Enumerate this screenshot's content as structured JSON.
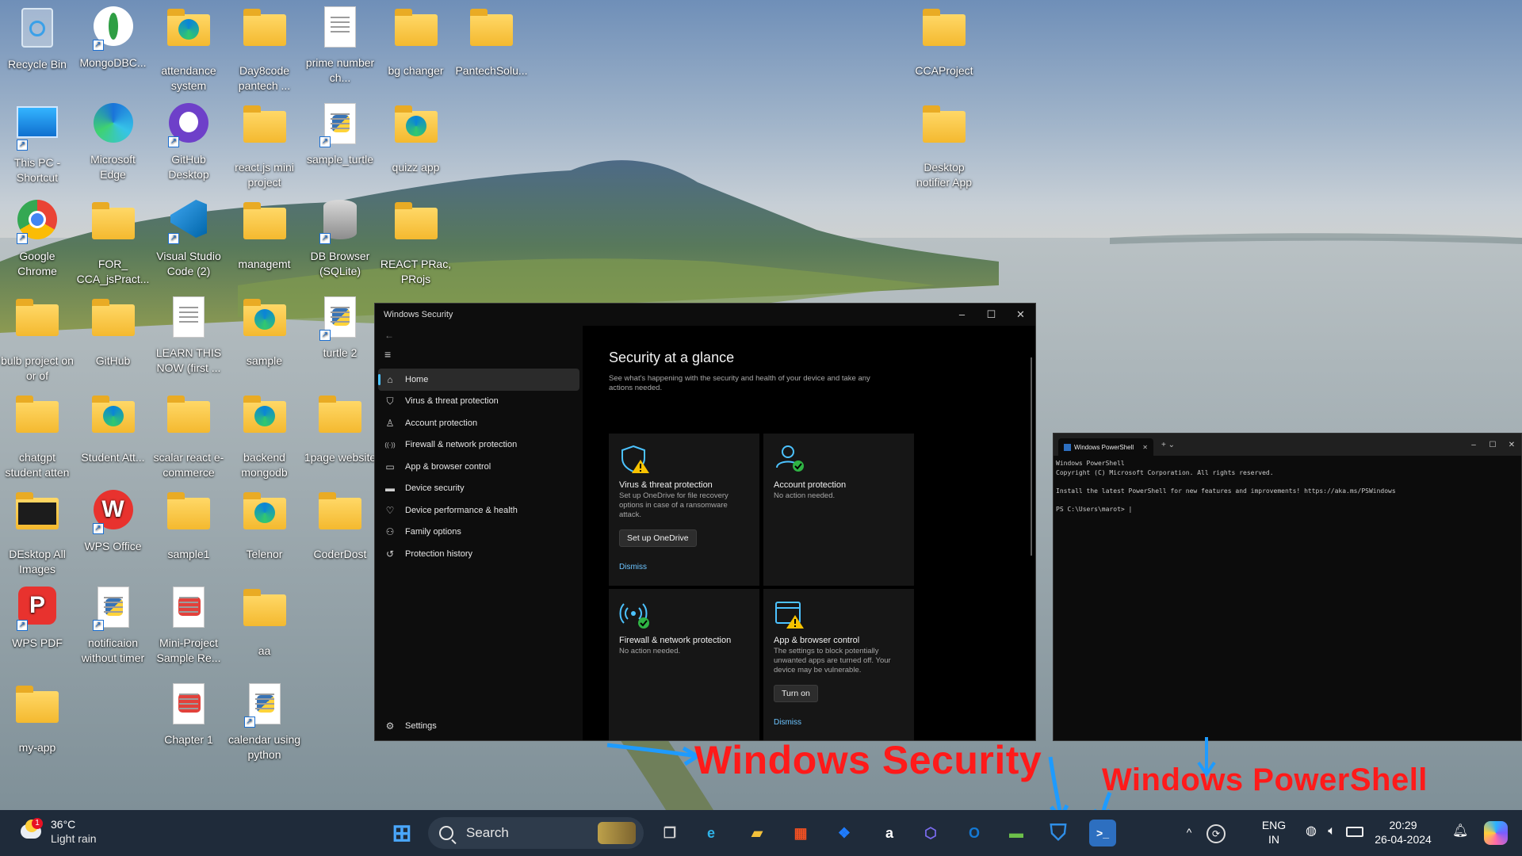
{
  "desktop_icons": [
    {
      "label": "Recycle Bin",
      "kind": "recycle-bin",
      "col": 0,
      "row": 0
    },
    {
      "label": "MongoDBC...",
      "kind": "mongodb",
      "col": 1,
      "row": 0
    },
    {
      "label": "attendance system",
      "kind": "folder-edge",
      "col": 2,
      "row": 0
    },
    {
      "label": "Day8code pantech ...",
      "kind": "folder",
      "col": 3,
      "row": 0
    },
    {
      "label": "prime number ch...",
      "kind": "document",
      "col": 4,
      "row": 0
    },
    {
      "label": "bg changer",
      "kind": "folder",
      "col": 5,
      "row": 0
    },
    {
      "label": "PantechSolu...",
      "kind": "folder",
      "col": 6,
      "row": 0
    },
    {
      "label": "CCAProject",
      "kind": "folder",
      "col": 12,
      "row": 0
    },
    {
      "label": "This PC - Shortcut",
      "kind": "monitor",
      "col": 0,
      "row": 1
    },
    {
      "label": "Microsoft Edge",
      "kind": "edge",
      "col": 1,
      "row": 1
    },
    {
      "label": "GitHub Desktop",
      "kind": "github",
      "col": 2,
      "row": 1
    },
    {
      "label": "react.js mini project",
      "kind": "folder",
      "col": 3,
      "row": 1
    },
    {
      "label": "sample_turtle",
      "kind": "python",
      "col": 4,
      "row": 1
    },
    {
      "label": "quizz app",
      "kind": "folder-edge",
      "col": 5,
      "row": 1
    },
    {
      "label": "Desktop notifier App",
      "kind": "folder",
      "col": 12,
      "row": 1
    },
    {
      "label": "Google Chrome",
      "kind": "chrome",
      "col": 0,
      "row": 2
    },
    {
      "label": "FOR_ CCA_jsPract...",
      "kind": "folder",
      "col": 1,
      "row": 2
    },
    {
      "label": "Visual Studio Code (2)",
      "kind": "vscode",
      "col": 2,
      "row": 2
    },
    {
      "label": "managemt",
      "kind": "folder",
      "col": 3,
      "row": 2
    },
    {
      "label": "DB Browser (SQLite)",
      "kind": "database",
      "col": 4,
      "row": 2
    },
    {
      "label": "REACT PRac, PRojs",
      "kind": "folder",
      "col": 5,
      "row": 2
    },
    {
      "label": "bulb project on or of",
      "kind": "folder",
      "col": 0,
      "row": 3
    },
    {
      "label": "GitHub",
      "kind": "folder",
      "col": 1,
      "row": 3
    },
    {
      "label": "LEARN THIS NOW (first ...",
      "kind": "document",
      "col": 2,
      "row": 3
    },
    {
      "label": "sample",
      "kind": "folder-edge",
      "col": 3,
      "row": 3
    },
    {
      "label": "turtle 2",
      "kind": "python",
      "col": 4,
      "row": 3
    },
    {
      "label": "chatgpt student atten",
      "kind": "folder",
      "col": 0,
      "row": 4
    },
    {
      "label": "Student Att...",
      "kind": "folder-edge",
      "col": 1,
      "row": 4
    },
    {
      "label": "scalar react e-commerce",
      "kind": "folder",
      "col": 2,
      "row": 4
    },
    {
      "label": "backend mongodb",
      "kind": "folder-edge",
      "col": 3,
      "row": 4
    },
    {
      "label": "1page website",
      "kind": "folder",
      "col": 4,
      "row": 4
    },
    {
      "label": "DEsktop All Images",
      "kind": "folder-dark",
      "col": 0,
      "row": 5
    },
    {
      "label": "WPS Office",
      "kind": "wps",
      "col": 1,
      "row": 5
    },
    {
      "label": "sample1",
      "kind": "folder",
      "col": 2,
      "row": 5
    },
    {
      "label": "Telenor",
      "kind": "folder-edge",
      "col": 3,
      "row": 5
    },
    {
      "label": "CoderDost",
      "kind": "folder",
      "col": 4,
      "row": 5
    },
    {
      "label": "WPS PDF",
      "kind": "wps-pdf",
      "col": 0,
      "row": 6
    },
    {
      "label": "notificaion without timer",
      "kind": "python",
      "col": 1,
      "row": 6
    },
    {
      "label": "Mini-Project Sample Re...",
      "kind": "pdf",
      "col": 2,
      "row": 6
    },
    {
      "label": "aa",
      "kind": "folder",
      "col": 3,
      "row": 6
    },
    {
      "label": "my-app",
      "kind": "folder",
      "col": 0,
      "row": 7
    },
    {
      "label": "Chapter 1",
      "kind": "pdf",
      "col": 2,
      "row": 7
    },
    {
      "label": "calendar using python",
      "kind": "python",
      "col": 3,
      "row": 7
    }
  ],
  "security_window": {
    "title": "Windows Security",
    "controls": {
      "minimize": "–",
      "maximize": "☐",
      "close": "✕"
    },
    "back": "←",
    "menu": "≡",
    "nav": [
      {
        "label": "Home",
        "icon": "home-icon",
        "glyph": "⌂",
        "active": true
      },
      {
        "label": "Virus & threat protection",
        "icon": "shield-icon",
        "glyph": "⛉",
        "active": false
      },
      {
        "label": "Account protection",
        "icon": "person-icon",
        "glyph": "♙",
        "active": false
      },
      {
        "label": "Firewall & network protection",
        "icon": "antenna-icon",
        "glyph": "((·))",
        "active": false
      },
      {
        "label": "App & browser control",
        "icon": "browser-icon",
        "glyph": "▭",
        "active": false
      },
      {
        "label": "Device security",
        "icon": "laptop-icon",
        "glyph": "▬",
        "active": false
      },
      {
        "label": "Device performance & health",
        "icon": "heart-icon",
        "glyph": "♡",
        "active": false
      },
      {
        "label": "Family options",
        "icon": "family-icon",
        "glyph": "⚇",
        "active": false
      },
      {
        "label": "Protection history",
        "icon": "history-icon",
        "glyph": "↺",
        "active": false
      }
    ],
    "settings_label": "Settings",
    "heading": "Security at a glance",
    "subheading": "See what's happening with the security and health of your device and take any actions needed.",
    "cards": [
      {
        "title": "Virus & threat protection",
        "desc": "Set up OneDrive for file recovery options in case of a ransomware attack.",
        "button": "Set up OneDrive",
        "link": "Dismiss",
        "status": "warning",
        "icon": "shield-warning-icon"
      },
      {
        "title": "Account protection",
        "desc": "No action needed.",
        "button": "",
        "link": "",
        "status": "ok",
        "icon": "account-ok-icon"
      },
      {
        "title": "Firewall & network protection",
        "desc": "No action needed.",
        "button": "",
        "link": "",
        "status": "ok",
        "icon": "firewall-ok-icon"
      },
      {
        "title": "App & browser control",
        "desc": "The settings to block potentially unwanted apps are turned off. Your device may be vulnerable.",
        "button": "Turn on",
        "link": "Dismiss",
        "status": "warning",
        "icon": "browser-warning-icon"
      }
    ]
  },
  "powershell_window": {
    "tab_title": "Windows PowerShell",
    "tab_close": "✕",
    "new_tab": "+  ⌄",
    "controls": {
      "minimize": "–",
      "maximize": "☐",
      "close": "✕"
    },
    "lines": [
      "Windows PowerShell",
      "Copyright (C) Microsoft Corporation. All rights reserved.",
      "",
      "Install the latest PowerShell for new features and improvements! https://aka.ms/PSWindows",
      "",
      "PS C:\\Users\\marot> |"
    ]
  },
  "annotations": {
    "security_label": "Windows Security",
    "powershell_label": "Windows PowerShell",
    "color": "#ff1a1a",
    "arrow_color": "#1e9bff"
  },
  "taskbar": {
    "weather_temp": "36°C",
    "weather_cond": "Light rain",
    "weather_badge": "1",
    "search_placeholder": "Search",
    "pinned_apps": [
      {
        "name": "start-button",
        "glyph": "⊞",
        "color": "#4aa8ff"
      },
      {
        "name": "task-view-button",
        "glyph": "❐",
        "color": "#d0d0d0"
      },
      {
        "name": "edge-taskbar-icon",
        "glyph": "e",
        "color": "#2fb3e8"
      },
      {
        "name": "file-explorer-taskbar-icon",
        "glyph": "▰",
        "color": "#f3c13a"
      },
      {
        "name": "microsoft-store-taskbar-icon",
        "glyph": "▦",
        "color": "#f25022"
      },
      {
        "name": "dropbox-taskbar-icon",
        "glyph": "❖",
        "color": "#1f7cff"
      },
      {
        "name": "amazon-taskbar-icon",
        "glyph": "a",
        "color": "#ffffff"
      },
      {
        "name": "copilot-taskbar-icon",
        "glyph": "⬡",
        "color": "#7b6cf0"
      },
      {
        "name": "outlook-taskbar-icon",
        "glyph": "O",
        "color": "#1479d4"
      },
      {
        "name": "terminal-green-taskbar-icon",
        "glyph": "▬",
        "color": "#6cc04a"
      },
      {
        "name": "windows-security-taskbar-icon",
        "glyph": "⛉",
        "color": "#2f8fe8"
      },
      {
        "name": "powershell-taskbar-icon",
        "glyph": ">_",
        "color": "#2d6fc0"
      }
    ],
    "tray": {
      "chevron": "^",
      "lang_top": "ENG",
      "lang_bottom": "IN",
      "time": "20:29",
      "date": "26-04-2024"
    }
  }
}
